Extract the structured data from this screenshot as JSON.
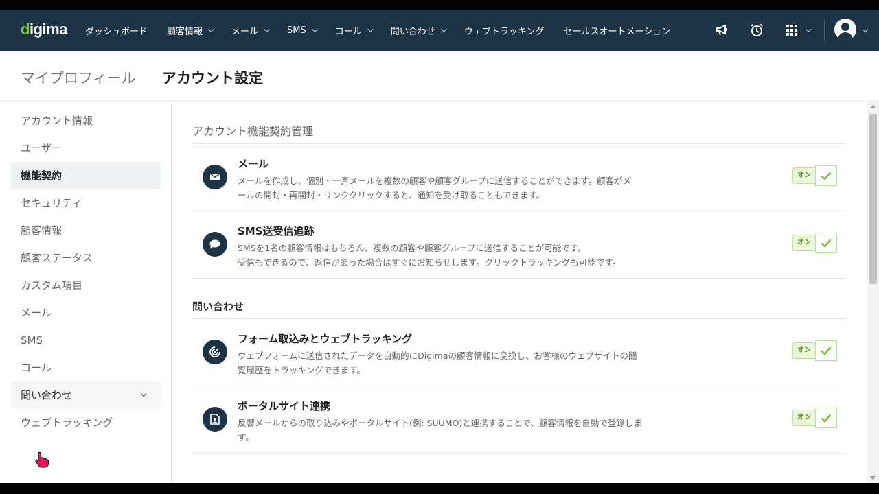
{
  "brand": {
    "logo_prefix": "d",
    "logo_rest": "igima",
    "accent": "#7fcf3a",
    "navbar_bg": "#1d3447"
  },
  "nav": {
    "items": [
      {
        "label": "ダッシュボード",
        "dropdown": false
      },
      {
        "label": "顧客情報",
        "dropdown": true
      },
      {
        "label": "メール",
        "dropdown": true
      },
      {
        "label": "SMS",
        "dropdown": true
      },
      {
        "label": "コール",
        "dropdown": true
      },
      {
        "label": "問い合わせ",
        "dropdown": true
      },
      {
        "label": "ウェブトラッキング",
        "dropdown": false
      },
      {
        "label": "セールスオートメーション",
        "dropdown": false
      }
    ],
    "icons": [
      "megaphone-icon",
      "alarm-clock-icon",
      "apps-grid-icon",
      "user-avatar-icon"
    ]
  },
  "header": {
    "tab_profile": "マイプロフィール",
    "tab_account": "アカウント設定"
  },
  "sidebar": {
    "items": [
      {
        "label": "アカウント情報"
      },
      {
        "label": "ユーザー"
      },
      {
        "label": "機能契約",
        "active": true
      },
      {
        "label": "セキュリティ"
      },
      {
        "label": "顧客情報"
      },
      {
        "label": "顧客ステータス"
      },
      {
        "label": "カスタム項目"
      },
      {
        "label": "メール"
      },
      {
        "label": "SMS"
      },
      {
        "label": "コール"
      },
      {
        "label": "問い合わせ",
        "expandable": true
      },
      {
        "label": "ウェブトラッキング"
      }
    ]
  },
  "main": {
    "section_title": "アカウント機能契約管理",
    "group_inquiry_title": "問い合わせ",
    "features": [
      {
        "icon": "envelope-icon",
        "title": "メール",
        "desc_line1": "メールを作成し、個別・一斉メールを複数の顧客や顧客グループに送信することができます。顧客がメ",
        "desc_line2": "ールの開封・再開封・リンククリックすると、通知を受け取ることもできます。",
        "toggle_label": "オン",
        "enabled": true
      },
      {
        "icon": "chat-bubble-icon",
        "title": "SMS送受信追跡",
        "desc_line1": "SMSを1名の顧客情報はもちろん、複数の顧客や顧客グループに送信することが可能です。",
        "desc_line2": "受信もできるので、返信があった場合はすぐにお知らせします。クリックトラッキングも可能です。",
        "toggle_label": "オン",
        "enabled": true
      },
      {
        "icon": "target-icon",
        "title": "フォーム取込みとウェブトラッキング",
        "desc_line1": "ウェブフォームに送信されたデータを自動的にDigimaの顧客情報に変換し、お客様のウェブサイトの閲",
        "desc_line2": "覧履歴をトラッキングできます。",
        "toggle_label": "オン",
        "enabled": true
      },
      {
        "icon": "document-user-icon",
        "title": "ポータルサイト連携",
        "desc_line1": "反響メールからの取り込みやポータルサイト(例: SUUMO)と連携することで、顧客情報を自動で登録しま",
        "desc_line2": "す。",
        "toggle_label": "オン",
        "enabled": true
      }
    ]
  }
}
